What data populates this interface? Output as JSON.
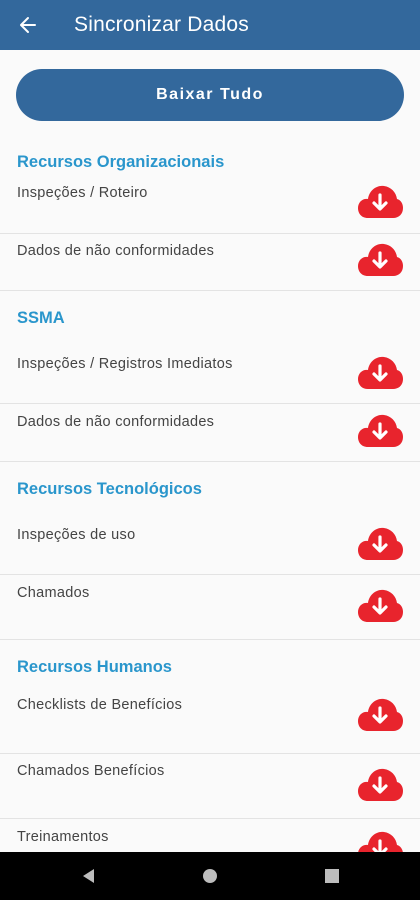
{
  "appbar": {
    "title": "Sincronizar Dados",
    "back_icon": "arrow-left-icon"
  },
  "download_all_label": "Baixar Tudo",
  "colors": {
    "primary": "#33689c",
    "section": "#2a96cc",
    "download_icon": "#e8242d",
    "text": "#444444"
  },
  "sections": [
    {
      "title": "Recursos Organizacionais",
      "items": [
        {
          "label": "Inspeções / Roteiro",
          "icon": "cloud-download-icon"
        },
        {
          "label": "Dados de não conformidades",
          "icon": "cloud-download-icon"
        }
      ]
    },
    {
      "title": "SSMA",
      "items": [
        {
          "label": "Inspeções / Registros Imediatos",
          "icon": "cloud-download-icon"
        },
        {
          "label": "Dados de não conformidades",
          "icon": "cloud-download-icon"
        }
      ]
    },
    {
      "title": "Recursos Tecnológicos",
      "items": [
        {
          "label": "Inspeções de uso",
          "icon": "cloud-download-icon"
        },
        {
          "label": "Chamados",
          "icon": "cloud-download-icon"
        }
      ]
    },
    {
      "title": "Recursos Humanos",
      "items": [
        {
          "label": "Checklists de Benefícios",
          "icon": "cloud-download-icon"
        },
        {
          "label": "Chamados Benefícios",
          "icon": "cloud-download-icon"
        },
        {
          "label": "Treinamentos",
          "icon": "cloud-download-icon"
        }
      ]
    }
  ],
  "navbar": {
    "back": "nav-back-icon",
    "home": "nav-home-icon",
    "recents": "nav-recents-icon"
  }
}
